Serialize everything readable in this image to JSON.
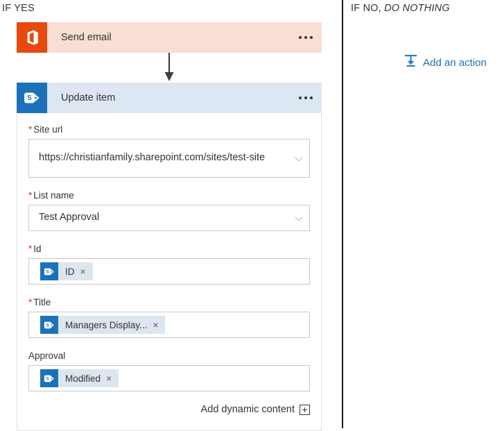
{
  "branches": {
    "yes_label": "IF YES",
    "no_label_prefix": "IF NO, ",
    "no_label_emphasis": "DO NOTHING"
  },
  "yes_branch": {
    "actions": [
      {
        "title": "Send email",
        "icon": "office-icon",
        "accent": "#e8490d",
        "header_bg": "#f9ded4",
        "menu": "overflow-menu"
      },
      {
        "title": "Update item",
        "icon": "sharepoint-icon",
        "accent": "#1b72b8",
        "header_bg": "#dce7f3",
        "menu": "overflow-menu"
      }
    ],
    "connector": "down-arrow",
    "form": {
      "fields": [
        {
          "label": "Site url",
          "required": true,
          "type": "combobox",
          "value": "https://christianfamily.sharepoint.com/sites/test-site",
          "tall": true
        },
        {
          "label": "List name",
          "required": true,
          "type": "combobox",
          "value": "Test Approval",
          "tall": false
        },
        {
          "label": "Id",
          "required": true,
          "type": "token",
          "token": {
            "text": "ID",
            "icon": "sharepoint-icon",
            "remove": "×"
          }
        },
        {
          "label": "Title",
          "required": true,
          "type": "token",
          "token": {
            "text": "Managers Display...",
            "icon": "sharepoint-icon",
            "remove": "×"
          }
        },
        {
          "label": "Approval",
          "required": false,
          "type": "token",
          "token": {
            "text": "Modified",
            "icon": "sharepoint-icon",
            "remove": "×"
          }
        }
      ],
      "add_dynamic_content": "Add dynamic content",
      "add_dynamic_content_icon": "plus-icon"
    }
  },
  "no_branch": {
    "add_action_label": "Add an action",
    "add_action_icon": "insert-action-icon",
    "link_color": "#1b72b8"
  }
}
